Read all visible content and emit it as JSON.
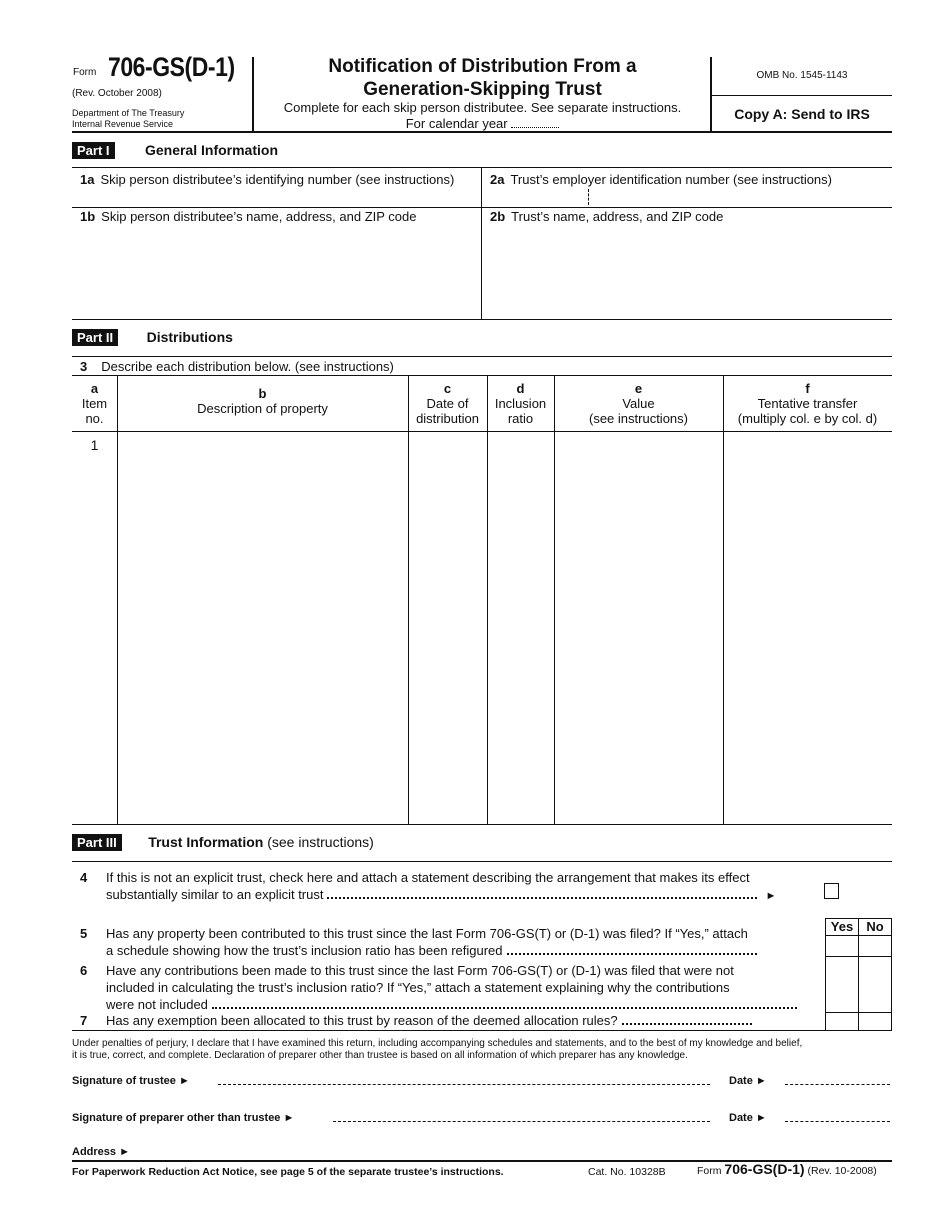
{
  "header": {
    "form_word": "Form",
    "form_number": "706-GS(D-1)",
    "revision": "(Rev. October 2008)",
    "department_line1": "Department of The Treasury",
    "department_line2": "Internal Revenue Service",
    "title_line1": "Notification of Distribution From a",
    "title_line2": "Generation-Skipping Trust",
    "subtitle": "Complete for each skip person distributee. See separate instructions.",
    "calendar_year_label": "For calendar year",
    "omb": "OMB No. 1545-1143",
    "copy": "Copy A: Send to IRS"
  },
  "part1": {
    "badge": "Part I",
    "title": "General Information",
    "line1a": {
      "num": "1a",
      "label": "Skip person distributee’s identifying number (see instructions)"
    },
    "line2a": {
      "num": "2a",
      "label": "Trust’s employer identification number (see instructions)"
    },
    "line1b": {
      "num": "1b",
      "label": "Skip person distributee’s name, address, and ZIP code"
    },
    "line2b": {
      "num": "2b",
      "label": "Trust’s name, address, and ZIP code"
    }
  },
  "part2": {
    "badge": "Part II",
    "title": "Distributions",
    "line3": {
      "num": "3",
      "label": "Describe each distribution below. (see instructions)"
    },
    "columns": [
      {
        "letter": "a",
        "line1": "Item",
        "line2": "no."
      },
      {
        "letter": "b",
        "line1": "Description of property",
        "line2": ""
      },
      {
        "letter": "c",
        "line1": "Date of",
        "line2": "distribution"
      },
      {
        "letter": "d",
        "line1": "Inclusion",
        "line2": "ratio"
      },
      {
        "letter": "e",
        "line1": "Value",
        "line2": "(see instructions)"
      },
      {
        "letter": "f",
        "line1": "Tentative transfer",
        "line2": "(multiply col. e by col. d)"
      }
    ],
    "rows": [
      {
        "item": "1",
        "description": "",
        "date": "",
        "ratio": "",
        "value": "",
        "transfer": ""
      }
    ]
  },
  "part3": {
    "badge": "Part III",
    "title": "Trust Information",
    "title_suffix": "(see instructions)",
    "yes_label": "Yes",
    "no_label": "No",
    "questions": [
      {
        "num": "4",
        "line1": "If this is not an explicit trust, check here and attach a statement describing the arrangement that makes its effect",
        "line2": "substantially similar to an explicit trust",
        "checked": false
      },
      {
        "num": "5",
        "line1": "Has any property been contributed to this trust since the last Form 706-GS(T) or (D-1) was filed? If “Yes,” attach",
        "line2": "a schedule showing how the trust’s inclusion ratio has been refigured",
        "answer": ""
      },
      {
        "num": "6",
        "line1": "Have any contributions been made to this trust since the last Form 706-GS(T) or (D-1) was filed that were not",
        "line2": "included in calculating the trust’s inclusion ratio? If “Yes,” attach a statement explaining why the contributions",
        "line3": "were not included",
        "answer": ""
      },
      {
        "num": "7",
        "line1": "Has any exemption been allocated to this trust by reason of the deemed allocation rules?",
        "answer": ""
      }
    ]
  },
  "signature": {
    "declaration_line1": "Under penalties of perjury, I declare that I have examined this return, including accompanying schedules and statements, and to the best of my knowledge and belief,",
    "declaration_line2": "it is true, correct, and complete. Declaration of preparer other than trustee is based on all information of which preparer has any knowledge.",
    "trustee_label": "Signature of trustee ►",
    "preparer_label": "Signature of preparer other than trustee ►",
    "date_label": "Date ►",
    "address_label": "Address ►",
    "trustee_signature": "",
    "trustee_date": "",
    "preparer_signature": "",
    "preparer_date": "",
    "address": ""
  },
  "footer": {
    "paperwork": "For Paperwork Reduction Act Notice, see page 5 of the separate trustee’s instructions.",
    "cat_no": "Cat. No. 10328B",
    "form_word": "Form",
    "form_number": "706-GS(D-1)",
    "revision": "(Rev. 10-2008)"
  }
}
